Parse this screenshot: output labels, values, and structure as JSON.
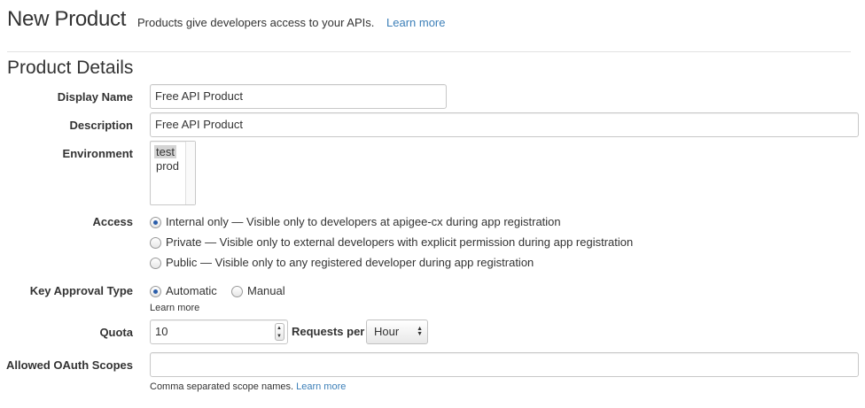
{
  "header": {
    "title": "New Product",
    "subtitle": "Products give developers access to your APIs.",
    "learn_more": "Learn more"
  },
  "section": {
    "title": "Product Details"
  },
  "form": {
    "display_name": {
      "label": "Display Name",
      "value": "Free API Product"
    },
    "description": {
      "label": "Description",
      "value": "Free API Product"
    },
    "environment": {
      "label": "Environment",
      "options": [
        "test",
        "prod"
      ],
      "selected": "test"
    },
    "access": {
      "label": "Access",
      "options": [
        "Internal only — Visible only to developers at apigee-cx during app registration",
        "Private — Visible only to external developers with explicit permission during app registration",
        "Public — Visible only to any registered developer during app registration"
      ],
      "selected_index": 0
    },
    "key_approval": {
      "label": "Key Approval Type",
      "options": [
        "Automatic",
        "Manual"
      ],
      "selected_index": 0,
      "learn_more": "Learn more"
    },
    "quota": {
      "label": "Quota",
      "value": "10",
      "requests_per_label": "Requests per",
      "unit": "Hour"
    },
    "oauth_scopes": {
      "label": "Allowed OAuth Scopes",
      "value": "",
      "help": "Comma separated scope names.",
      "learn_more": "Learn more"
    }
  },
  "colors": {
    "link": "#3c7fb8",
    "radio_dot": "#2a5daa"
  },
  "icons": {
    "stepper_up": "triangle-up",
    "stepper_down": "triangle-down",
    "select": "up-down-arrows"
  }
}
